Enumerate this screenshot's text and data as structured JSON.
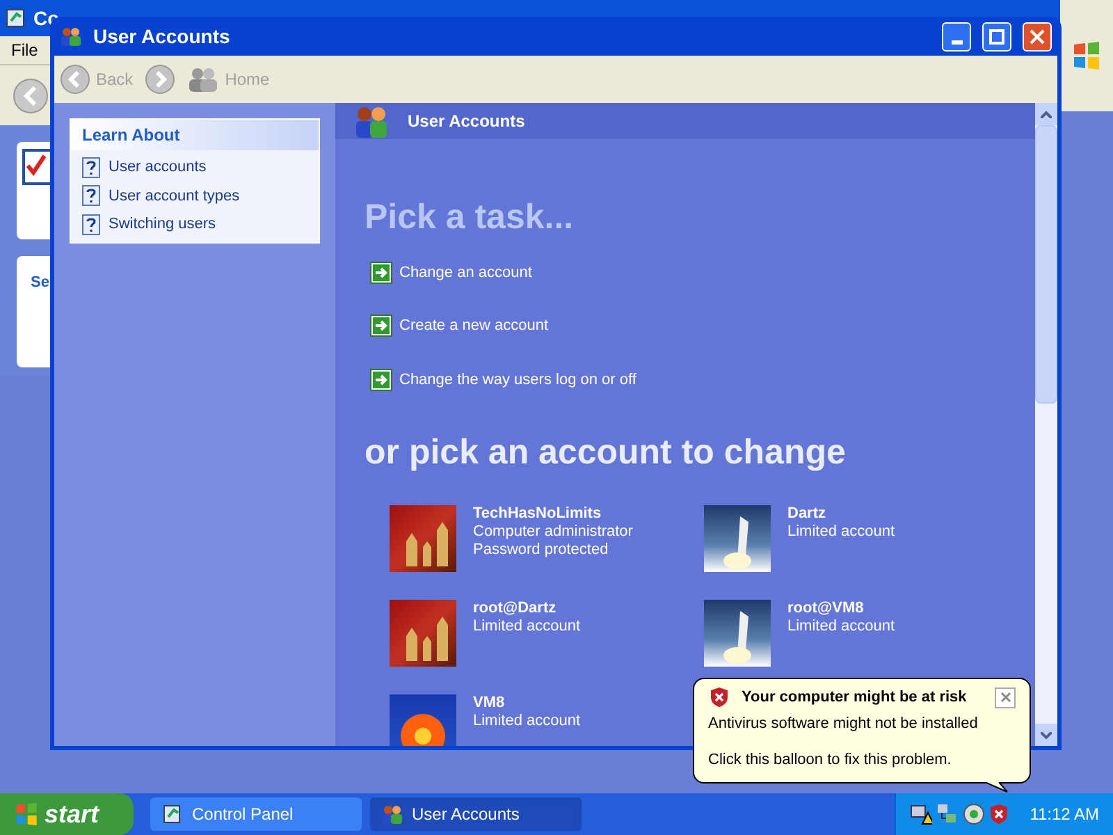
{
  "background_window": {
    "title": "Co",
    "menu": [
      "File"
    ],
    "panel_text": "Se"
  },
  "window": {
    "title": "User Accounts",
    "toolbar": [
      {
        "kind": "back",
        "label": "Back",
        "disabled": true
      },
      {
        "kind": "forward",
        "disabled": true
      },
      {
        "kind": "home",
        "label": "Home",
        "disabled": true
      }
    ],
    "learn_about": {
      "title": "Learn About",
      "items": [
        "User accounts",
        "User account types",
        "Switching users"
      ]
    },
    "header": "User Accounts",
    "task_heading": "Pick a task...",
    "tasks": [
      "Change an account",
      "Create a new account",
      "Change the way users log on or off"
    ],
    "account_heading": "or pick an account to change",
    "accounts": [
      {
        "name": "TechHasNoLimits",
        "details": [
          "Computer administrator",
          "Password protected"
        ],
        "kind": "chess"
      },
      {
        "name": "Dartz",
        "details": [
          "Limited account"
        ],
        "kind": "shuttle"
      },
      {
        "name": "root@Dartz",
        "details": [
          "Limited account"
        ],
        "kind": "chess"
      },
      {
        "name": "root@VM8",
        "details": [
          "Limited account"
        ],
        "kind": "shuttle"
      },
      {
        "name": "VM8",
        "details": [
          "Limited account"
        ],
        "kind": "flower"
      }
    ]
  },
  "balloon": {
    "title": "Your computer might be at risk",
    "lines": [
      "Antivirus software might not be installed",
      "Click this balloon to fix this problem."
    ]
  },
  "taskbar": {
    "start": "start",
    "buttons": [
      {
        "label": "Control Panel",
        "selected": false
      },
      {
        "label": "User Accounts",
        "selected": true
      }
    ],
    "clock": "11:12 AM"
  }
}
